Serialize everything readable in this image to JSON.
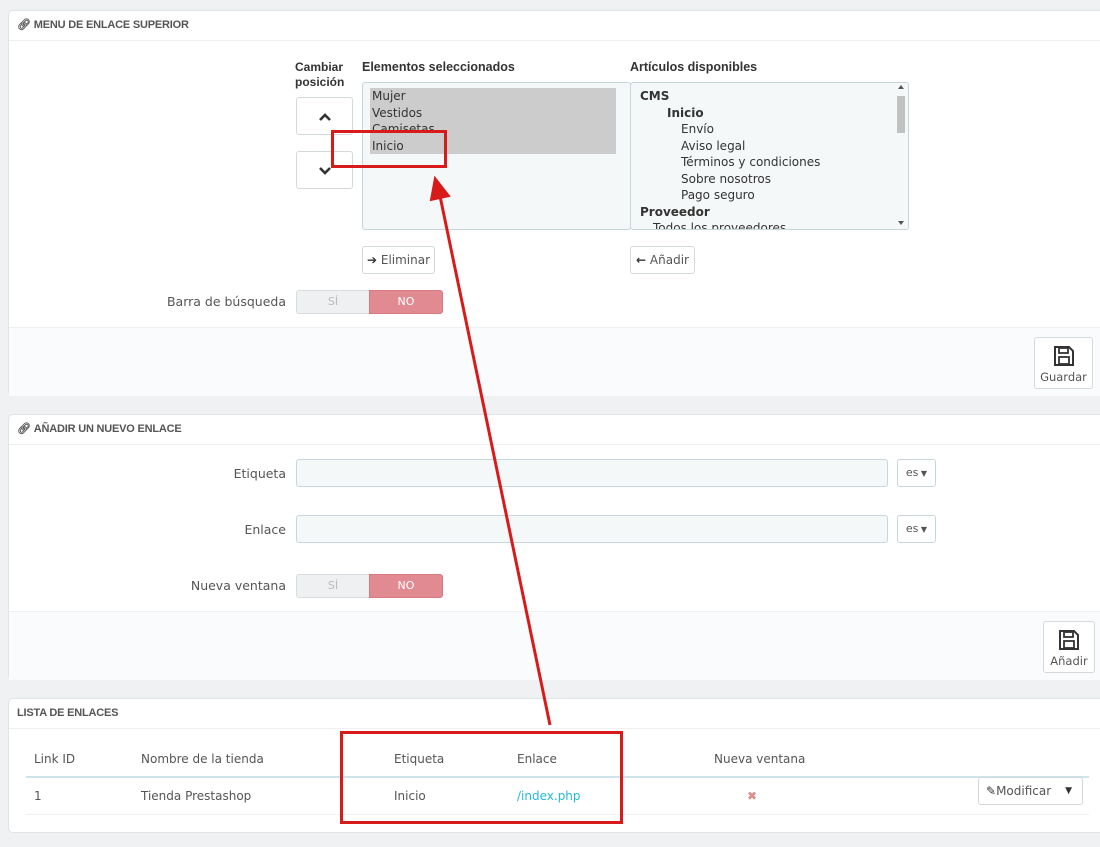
{
  "panel_menu": {
    "title": "MENU DE ENLACE SUPERIOR",
    "change_position_label": "Cambiar posición",
    "change_position_line1": "Cambiar",
    "change_position_line2": "posición",
    "selected_header": "Elementos seleccionados",
    "available_header": "Artículos disponibles",
    "selected_items": [
      "Mujer",
      "Vestidos",
      "Camisetas",
      "Inicio"
    ],
    "available_items": [
      {
        "text": "CMS",
        "level": 0,
        "bold": true
      },
      {
        "text": "Inicio",
        "level": 1,
        "bold": true
      },
      {
        "text": "Envío",
        "level": 2,
        "bold": false
      },
      {
        "text": "Aviso legal",
        "level": 2,
        "bold": false
      },
      {
        "text": "Términos y condiciones",
        "level": 2,
        "bold": false
      },
      {
        "text": "Sobre nosotros",
        "level": 2,
        "bold": false
      },
      {
        "text": "Pago seguro",
        "level": 2,
        "bold": false
      },
      {
        "text": "Proveedor",
        "level": 0,
        "bold": true
      },
      {
        "text": "Todos los proveedores",
        "level": 1,
        "bold": false
      }
    ],
    "remove_label": "Eliminar",
    "add_label": "Añadir",
    "search_bar_label": "Barra de búsqueda",
    "toggle_yes": "SÍ",
    "toggle_no": "NO",
    "save_label": "Guardar"
  },
  "panel_new_link": {
    "title": "AÑADIR UN NUEVO ENLACE",
    "label_field": "Etiqueta",
    "link_field": "Enlace",
    "lang": "es",
    "new_window_label": "Nueva ventana",
    "toggle_yes": "SÍ",
    "toggle_no": "NO",
    "add_label": "Añadir"
  },
  "panel_list": {
    "title": "LISTA DE ENLACES",
    "columns": [
      "Link ID",
      "Nombre de la tienda",
      "Etiqueta",
      "Enlace",
      "Nueva ventana"
    ],
    "rows": [
      {
        "id": "1",
        "shop": "Tienda Prestashop",
        "label": "Inicio",
        "link": "/index.php",
        "new_window": "✖"
      }
    ],
    "edit_label": "Modificar"
  },
  "colors": {
    "accent_link": "#25b9d7",
    "toggle_no": "#e28a92",
    "annotation_red": "#d91a1a",
    "selected_bg": "#cccccc"
  },
  "icons": {
    "link": "link-icon",
    "up": "chevron-up-icon",
    "down": "chevron-down-icon",
    "arrow_right": "arrow-right-icon",
    "arrow_left": "arrow-left-icon",
    "save": "floppy-disk-icon",
    "pencil": "pencil-icon",
    "close": "close-icon",
    "caret": "caret-down-icon"
  }
}
